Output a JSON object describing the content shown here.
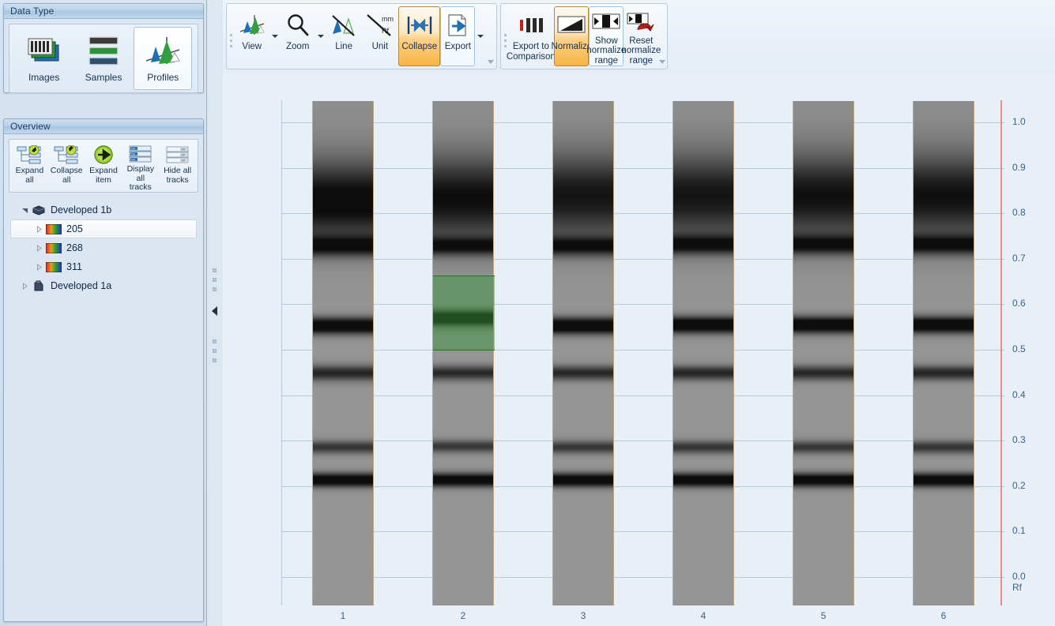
{
  "data_type_panel": {
    "title": "Data Type",
    "buttons": [
      {
        "label": "Images",
        "icon": "images-icon",
        "selected": false
      },
      {
        "label": "Samples",
        "icon": "samples-icon",
        "selected": false
      },
      {
        "label": "Profiles",
        "icon": "profiles-icon",
        "selected": true
      }
    ]
  },
  "overview_panel": {
    "title": "Overview",
    "buttons": [
      {
        "label": "Expand\nall",
        "icon": "expand-all-icon"
      },
      {
        "label": "Collapse\nall",
        "icon": "collapse-all-icon"
      },
      {
        "label": "Expand\nitem",
        "icon": "expand-item-icon"
      },
      {
        "label": "Display all\ntracks",
        "icon": "display-all-tracks-icon"
      },
      {
        "label": "Hide all\ntracks",
        "icon": "hide-all-tracks-icon"
      }
    ],
    "tree": [
      {
        "label": "Developed 1b",
        "level": 0,
        "expanded": true,
        "icon": "plate-icon",
        "selected": false
      },
      {
        "label": "205",
        "level": 1,
        "expanded": false,
        "icon": "spectrum-icon",
        "selected": true
      },
      {
        "label": "268",
        "level": 1,
        "expanded": false,
        "icon": "spectrum-icon",
        "selected": false
      },
      {
        "label": "311",
        "level": 1,
        "expanded": false,
        "icon": "spectrum-icon",
        "selected": false
      },
      {
        "label": "Developed 1a",
        "level": 0,
        "expanded": false,
        "icon": "plate-icon",
        "selected": false
      }
    ]
  },
  "ribbon": {
    "groups": [
      {
        "name": "view-group",
        "buttons": [
          {
            "label": "View",
            "icon": "profile-curve-icon",
            "state": "normal",
            "dropdown": true
          },
          {
            "label": "Zoom",
            "icon": "magnifier-icon",
            "state": "normal",
            "dropdown": true
          },
          {
            "label": "Line",
            "icon": "line-off-icon",
            "state": "normal",
            "dropdown": false
          },
          {
            "label": "Unit",
            "icon": "unit-mm-rf-icon",
            "state": "normal",
            "dropdown": false
          },
          {
            "label": "Collapse",
            "icon": "collapse-arrows-icon",
            "state": "active",
            "dropdown": false
          },
          {
            "label": "Export",
            "icon": "export-page-icon",
            "state": "outlined",
            "dropdown": true
          }
        ]
      },
      {
        "name": "normalize-group",
        "buttons": [
          {
            "label": "Export to\nComparison",
            "icon": "export-comparison-icon",
            "state": "normal",
            "dropdown": false
          },
          {
            "label": "Normalize",
            "icon": "normalize-icon",
            "state": "active",
            "dropdown": false
          },
          {
            "label": "Show\nnormalize\nrange",
            "icon": "show-range-icon",
            "state": "outlined",
            "dropdown": false
          },
          {
            "label": "Reset\nnormalize\nrange",
            "icon": "reset-range-icon",
            "state": "normal",
            "dropdown": false
          }
        ]
      }
    ]
  },
  "chart_data": {
    "type": "heatmap",
    "title": "",
    "xlabel": "",
    "ylabel": "Rf",
    "axis_title": "Rf",
    "ylim": [
      0.0,
      1.0
    ],
    "yticks": [
      "1.0",
      "0.9",
      "0.8",
      "0.7",
      "0.6",
      "0.5",
      "0.4",
      "0.3",
      "0.2",
      "0.1",
      "0.0"
    ],
    "ytick_values": [
      1.0,
      0.9,
      0.8,
      0.7,
      0.6,
      0.5,
      0.4,
      0.3,
      0.2,
      0.1,
      0.0
    ],
    "grid": true,
    "legend": "none",
    "categories": [
      "1",
      "2",
      "3",
      "4",
      "5",
      "6"
    ],
    "selection": {
      "track": "2",
      "rf_from": 0.5,
      "rf_to": 0.665,
      "color": "#3c963c"
    },
    "normalize_range_marker_color": "#f08a8a",
    "series": [
      {
        "name": "1",
        "bands": [
          {
            "rf": 0.845,
            "intensity": 0.72,
            "width": 0.085
          },
          {
            "rf": 0.745,
            "intensity": 0.62,
            "width": 0.022
          },
          {
            "rf": 0.568,
            "intensity": 0.92,
            "width": 0.018
          },
          {
            "rf": 0.463,
            "intensity": 0.58,
            "width": 0.017
          },
          {
            "rf": 0.298,
            "intensity": 0.5,
            "width": 0.014
          },
          {
            "rf": 0.225,
            "intensity": 0.9,
            "width": 0.015
          }
        ]
      },
      {
        "name": "2",
        "bands": [
          {
            "rf": 0.85,
            "intensity": 0.66,
            "width": 0.09
          },
          {
            "rf": 0.745,
            "intensity": 0.6,
            "width": 0.02
          },
          {
            "rf": 0.585,
            "intensity": 0.93,
            "width": 0.017
          },
          {
            "rf": 0.463,
            "intensity": 0.56,
            "width": 0.016
          },
          {
            "rf": 0.3,
            "intensity": 0.48,
            "width": 0.014
          },
          {
            "rf": 0.225,
            "intensity": 0.88,
            "width": 0.015
          }
        ]
      },
      {
        "name": "3",
        "bands": [
          {
            "rf": 0.855,
            "intensity": 0.62,
            "width": 0.09
          },
          {
            "rf": 0.745,
            "intensity": 0.62,
            "width": 0.021
          },
          {
            "rf": 0.568,
            "intensity": 0.93,
            "width": 0.018
          },
          {
            "rf": 0.463,
            "intensity": 0.57,
            "width": 0.016
          },
          {
            "rf": 0.298,
            "intensity": 0.49,
            "width": 0.014
          },
          {
            "rf": 0.225,
            "intensity": 0.9,
            "width": 0.015
          }
        ]
      },
      {
        "name": "4",
        "bands": [
          {
            "rf": 0.855,
            "intensity": 0.62,
            "width": 0.09
          },
          {
            "rf": 0.748,
            "intensity": 0.64,
            "width": 0.021
          },
          {
            "rf": 0.57,
            "intensity": 0.94,
            "width": 0.018
          },
          {
            "rf": 0.463,
            "intensity": 0.58,
            "width": 0.016
          },
          {
            "rf": 0.298,
            "intensity": 0.5,
            "width": 0.014
          },
          {
            "rf": 0.225,
            "intensity": 0.9,
            "width": 0.015
          }
        ]
      },
      {
        "name": "5",
        "bands": [
          {
            "rf": 0.855,
            "intensity": 0.64,
            "width": 0.09
          },
          {
            "rf": 0.748,
            "intensity": 0.63,
            "width": 0.021
          },
          {
            "rf": 0.57,
            "intensity": 0.94,
            "width": 0.018
          },
          {
            "rf": 0.463,
            "intensity": 0.57,
            "width": 0.016
          },
          {
            "rf": 0.298,
            "intensity": 0.49,
            "width": 0.014
          },
          {
            "rf": 0.225,
            "intensity": 0.89,
            "width": 0.015
          }
        ]
      },
      {
        "name": "6",
        "bands": [
          {
            "rf": 0.855,
            "intensity": 0.64,
            "width": 0.09
          },
          {
            "rf": 0.748,
            "intensity": 0.64,
            "width": 0.021
          },
          {
            "rf": 0.57,
            "intensity": 0.94,
            "width": 0.018
          },
          {
            "rf": 0.463,
            "intensity": 0.58,
            "width": 0.016
          },
          {
            "rf": 0.298,
            "intensity": 0.5,
            "width": 0.014
          },
          {
            "rf": 0.225,
            "intensity": 0.9,
            "width": 0.015
          }
        ]
      }
    ]
  }
}
